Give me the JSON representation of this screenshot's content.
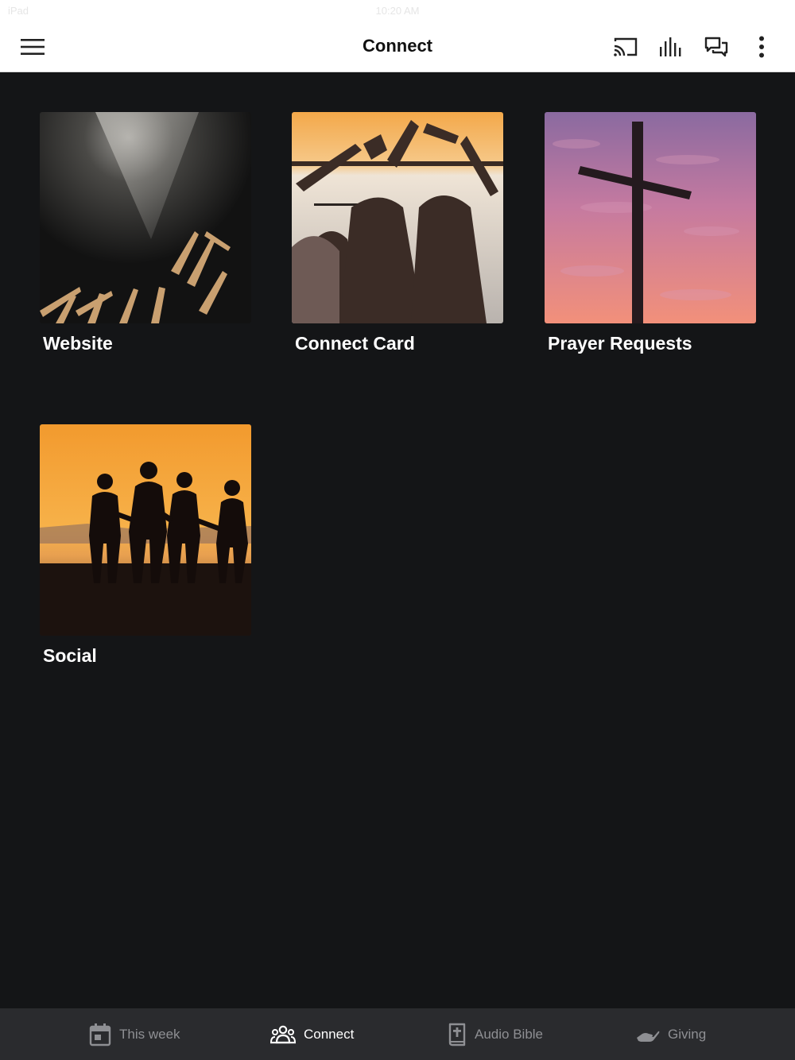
{
  "status_bar": {
    "carrier": "iPad",
    "time": "10:20 AM"
  },
  "header": {
    "title": "Connect",
    "icons": [
      "menu-icon",
      "cast-icon",
      "audio-bars-icon",
      "chat-icon",
      "more-vert-icon"
    ]
  },
  "tiles": [
    {
      "label": "Website",
      "image": "worship-hands-spotlight"
    },
    {
      "label": "Connect Card",
      "image": "heart-hands-sunset"
    },
    {
      "label": "Prayer Requests",
      "image": "cross-pink-sky"
    },
    {
      "label": "Social",
      "image": "friends-silhouette-sunset"
    }
  ],
  "bottom_nav": {
    "items": [
      {
        "label": "This week",
        "icon": "calendar-icon",
        "active": false
      },
      {
        "label": "Connect",
        "icon": "people-icon",
        "active": true
      },
      {
        "label": "Audio Bible",
        "icon": "bible-icon",
        "active": false
      },
      {
        "label": "Giving",
        "icon": "giving-hand-icon",
        "active": false
      }
    ]
  },
  "colors": {
    "background": "#141517",
    "app_bar": "#ffffff",
    "nav_bar": "#2a2b2e",
    "nav_active": "#ffffff",
    "nav_inactive": "#8e8f93"
  }
}
